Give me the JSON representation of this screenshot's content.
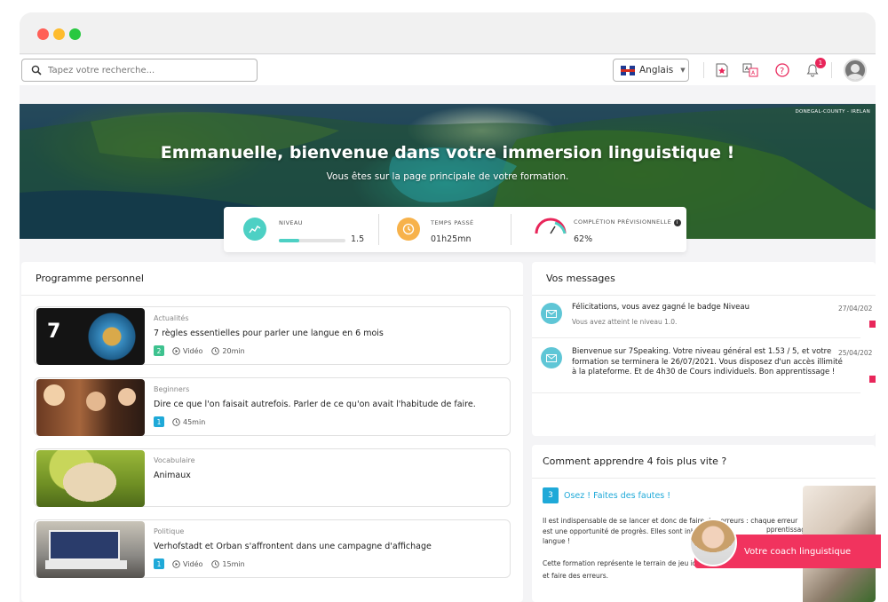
{
  "search": {
    "placeholder": "Tapez votre recherche..."
  },
  "header": {
    "language": "Anglais",
    "notifications_count": "1",
    "icons": [
      "flag-star-icon",
      "translate-icon",
      "help-icon",
      "bell-icon",
      "user-avatar"
    ]
  },
  "hero": {
    "location_tag": "DONEGAL-COUNTY - IRELAN",
    "title": "Emmanuelle, bienvenue dans votre immersion linguistique !",
    "subtitle": "Vous êtes sur la page principale de votre formation."
  },
  "stats": {
    "niveau_label": "NIVEAU",
    "niveau_value": "1.5",
    "niveau_progress": 0.3,
    "temps_label": "TEMPS PASSÉ",
    "temps_value": "01h25mn",
    "completion_label": "COMPLÉTION PRÉVISIONNELLE",
    "completion_value": "62%"
  },
  "programme": {
    "title": "Programme personnel",
    "courses": [
      {
        "category": "Actualités",
        "title": "7 règles essentielles pour parler une langue en 6 mois",
        "level": "2",
        "level_color": "#3ec28f",
        "type": "Vidéo",
        "duration": "20min"
      },
      {
        "category": "Beginners",
        "title": "Dire ce que l'on faisait autrefois. Parler de ce qu'on avait l'habitude de faire.",
        "level": "1",
        "level_color": "#1fa9d8",
        "type": "",
        "duration": "45min"
      },
      {
        "category": "Vocabulaire",
        "title": "Animaux",
        "level": "",
        "type": "",
        "duration": ""
      },
      {
        "category": "Politique",
        "title": "Verhofstadt et Orban s'affrontent dans une campagne d'affichage",
        "level": "1",
        "level_color": "#1fa9d8",
        "type": "Vidéo",
        "duration": "15min"
      }
    ]
  },
  "messages": {
    "title": "Vos messages",
    "items": [
      {
        "text": "Félicitations, vous avez gagné le badge Niveau",
        "sub": "Vous avez atteint le niveau 1.0.",
        "date": "27/04/202"
      },
      {
        "text_lines": [
          "Bienvenue sur 7Speaking. Votre niveau général est 1.53 / 5, et votre",
          "formation se terminera le 26/07/2021. Vous disposez d'un accès illimité",
          "à la plateforme. Et de 4h30 de Cours individuels. Bon apprentissage !"
        ],
        "date": "25/04/202"
      }
    ]
  },
  "tips": {
    "title": "Comment apprendre 4 fois plus vite ?",
    "number": "3",
    "heading": "Osez ! Faites des fautes !",
    "para1": [
      "Il est indispensable de se lancer et donc de faire des erreurs : chaque erreur",
      "est une opportunité de progrès. Elles sont inh",
      "langue !"
    ],
    "para1_right": "pprentissage de la",
    "para2": [
      "Cette formation représente le terrain de jeu id",
      "et faire des erreurs."
    ]
  },
  "coach": {
    "label": "Votre coach linguistique"
  }
}
